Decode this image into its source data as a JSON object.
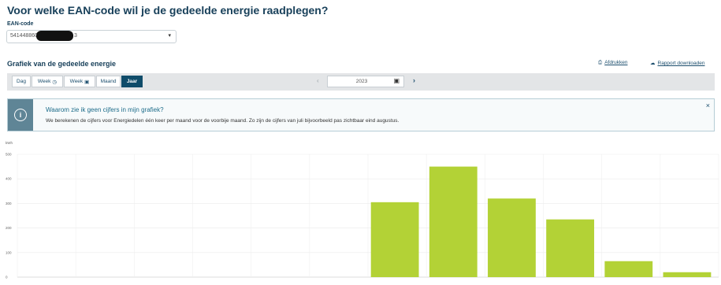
{
  "page": {
    "question": "Voor welke EAN-code wil je de gedeelde energie raadplegen?"
  },
  "ean": {
    "label": "EAN-code",
    "value_prefix": "541448860",
    "value_suffix": "3"
  },
  "graph": {
    "title": "Grafiek van de gedeelde energie",
    "print_label": "Afdrukken",
    "download_label": "Rapport downloaden"
  },
  "periods": [
    {
      "label": "Dag",
      "icon": "",
      "active": false
    },
    {
      "label": "Week",
      "icon": "clock-icon",
      "active": false
    },
    {
      "label": "Week",
      "icon": "calendar-icon",
      "active": false
    },
    {
      "label": "Maand",
      "icon": "",
      "active": false
    },
    {
      "label": "Jaar",
      "icon": "",
      "active": true
    }
  ],
  "year_picker": {
    "value": "2023"
  },
  "info": {
    "title": "Waarom zie ik geen cijfers in mijn grafiek?",
    "text": "We berekenen de cijfers voor Energiedelen één keer per maand voor de voorbije maand. Zo zijn de cijfers van juli bijvoorbeeld pas zichtbaar eind augustus."
  },
  "chart_data": {
    "type": "bar",
    "ylabel": "kWh",
    "ylim": [
      0,
      500
    ],
    "yticks": [
      0,
      100,
      200,
      300,
      400,
      500
    ],
    "grid": true,
    "bar_color": "#b3d236",
    "categories": [
      "",
      "",
      "",
      "",
      "",
      "",
      "",
      "",
      "",
      "",
      "",
      ""
    ],
    "values": [
      0,
      0,
      0,
      0,
      0,
      0,
      305,
      450,
      320,
      235,
      65,
      20
    ]
  }
}
